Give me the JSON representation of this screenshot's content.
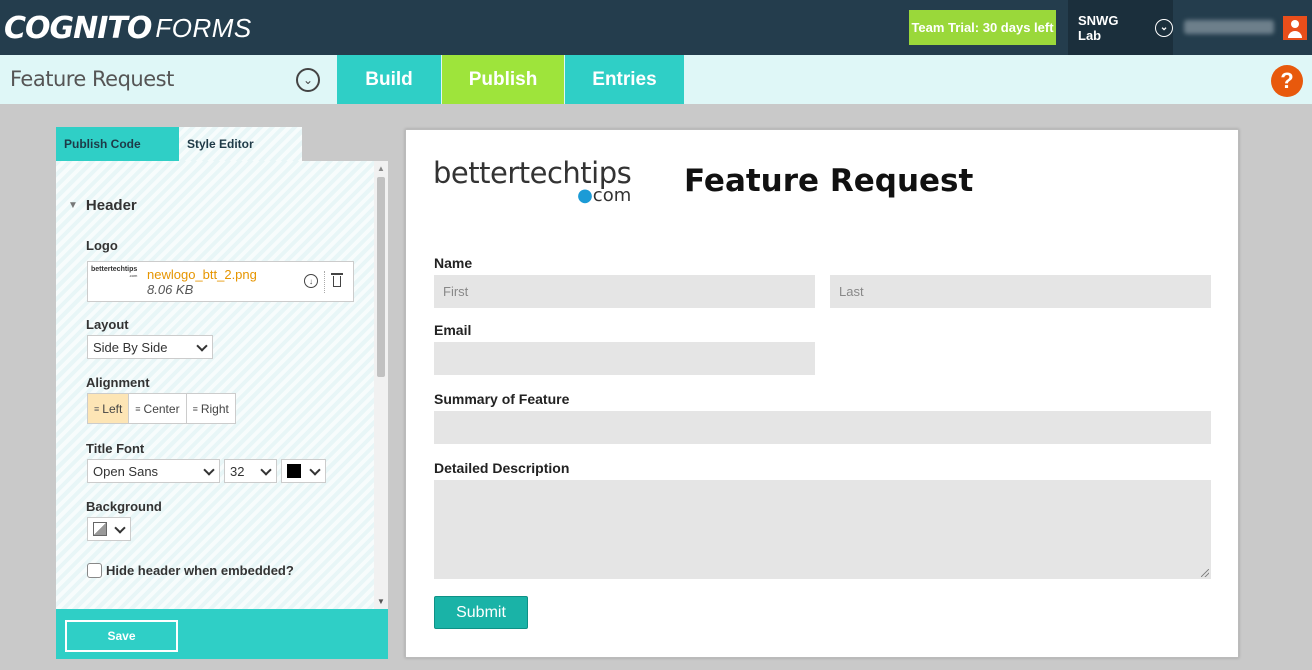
{
  "header": {
    "brand_cog": "COGNITO",
    "brand_forms": "FORMS",
    "trial_label": "Team Trial: 30 days left",
    "org_label": "SNWG Lab"
  },
  "subbar": {
    "form_title": "Feature Request",
    "tabs": [
      {
        "label": "Build"
      },
      {
        "label": "Publish"
      },
      {
        "label": "Entries"
      }
    ],
    "help_label": "?"
  },
  "panel": {
    "subtabs": [
      {
        "label": "Publish Code"
      },
      {
        "label": "Style Editor"
      }
    ],
    "section_title": "Header",
    "logo": {
      "label": "Logo",
      "thumb_text": "bettertechtips",
      "thumb_small": ".com",
      "file_name": "newlogo_btt_2.png",
      "file_size": "8.06 KB"
    },
    "layout": {
      "label": "Layout",
      "value": "Side By Side"
    },
    "alignment": {
      "label": "Alignment",
      "options": [
        "Left",
        "Center",
        "Right"
      ],
      "selected": "Left"
    },
    "title_font": {
      "label": "Title Font",
      "family": "Open Sans",
      "size": "32",
      "color": "#000000"
    },
    "background": {
      "label": "Background"
    },
    "hide_header": {
      "label": "Hide header when embedded?",
      "checked": false
    },
    "save_label": "Save"
  },
  "preview": {
    "logo_main": "bettertechtips",
    "logo_dotcom": "com",
    "title": "Feature Request",
    "fields": {
      "name_label": "Name",
      "first_placeholder": "First",
      "last_placeholder": "Last",
      "email_label": "Email",
      "summary_label": "Summary of Feature",
      "description_label": "Detailed Description"
    },
    "submit_label": "Submit"
  },
  "colors": {
    "topbar": "#243d4d",
    "teal": "#2fcfc6",
    "green": "#9ee43b",
    "orange": "#e8590c",
    "submit": "#1ab3a7"
  }
}
